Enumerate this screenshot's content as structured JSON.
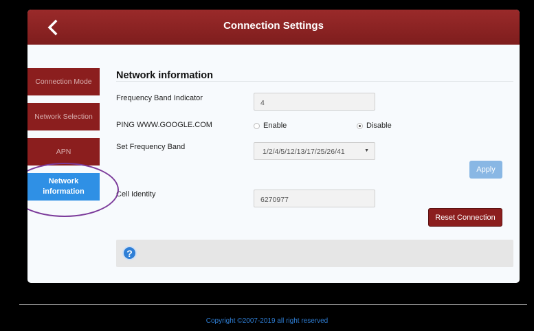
{
  "header": {
    "title": "Connection Settings"
  },
  "sidebar": {
    "items": [
      {
        "label": "Connection Mode"
      },
      {
        "label": "Network Selection"
      },
      {
        "label": "APN"
      }
    ],
    "active": {
      "line1": "Network",
      "line2": "information"
    }
  },
  "section": {
    "title": "Network information"
  },
  "fields": {
    "frequency_band_indicator": {
      "label": "Frequency Band Indicator",
      "value": "4"
    },
    "ping": {
      "label": "PING WWW.GOOGLE.COM",
      "enable": "Enable",
      "disable": "Disable",
      "selected": "Disable"
    },
    "set_frequency_band": {
      "label": "Set Frequency Band",
      "value": "1/2/4/5/12/13/17/25/26/41"
    },
    "cell_identity": {
      "label": "Cell Identity",
      "value": "6270977"
    }
  },
  "buttons": {
    "apply": "Apply",
    "reset": "Reset Connection"
  },
  "help": {
    "icon": "?"
  },
  "footer": {
    "copyright": "Copyright ©2007-2019 all right reserved"
  },
  "colors": {
    "header": "#8b1e1e",
    "active_nav": "#2f90e5",
    "accent": "#2f7fd6"
  },
  "icons": {
    "back": "chevron-left-icon",
    "help": "help-icon",
    "select_caret": "caret-down-icon"
  }
}
